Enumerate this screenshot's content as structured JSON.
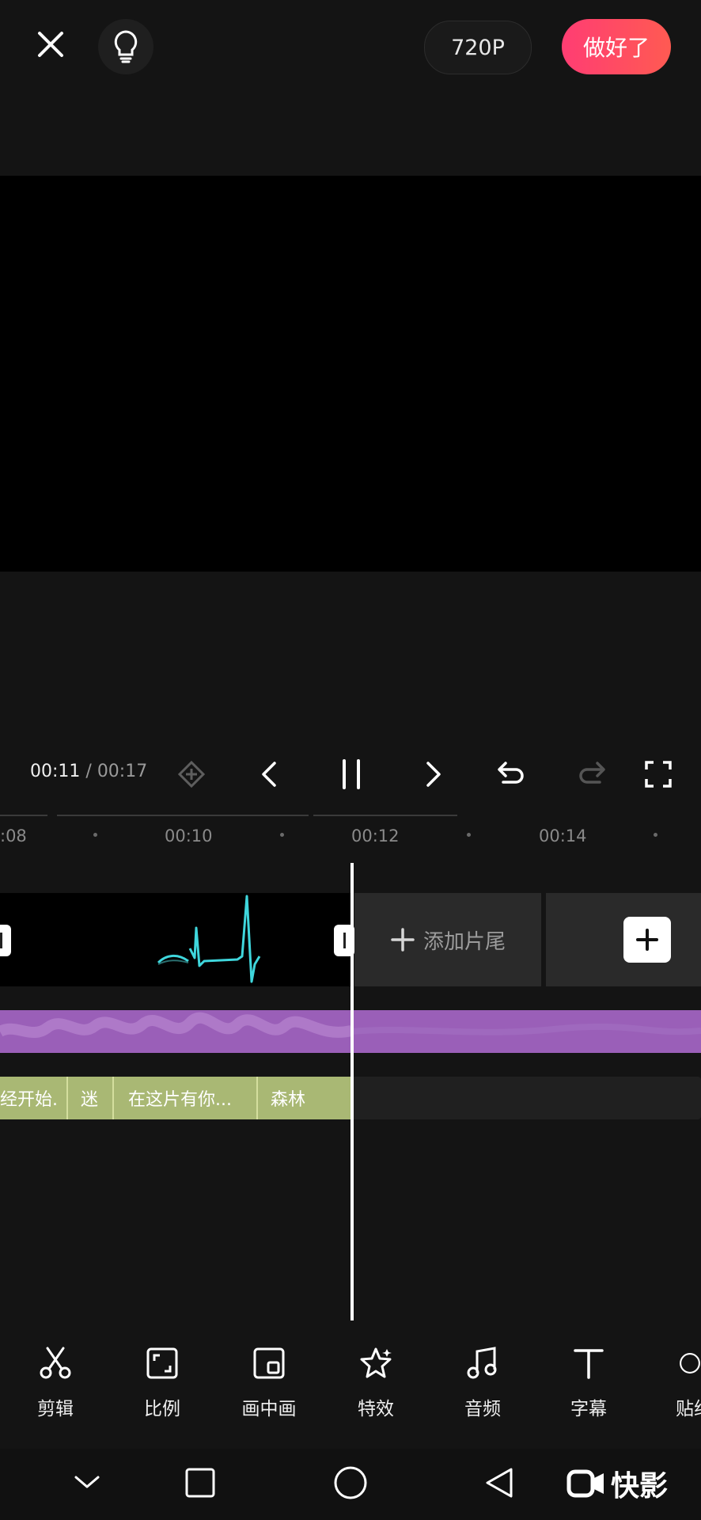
{
  "header": {
    "quality_label": "720P",
    "done_label": "做好了"
  },
  "player": {
    "current_time": "00:11",
    "separator": " / ",
    "total_time": "00:17"
  },
  "ruler": {
    "ticks": [
      ":08",
      "00:10",
      "00:12",
      "00:14"
    ]
  },
  "timeline": {
    "add_ending_label": "添加片尾",
    "captions": [
      "经开始.",
      "迷",
      "在这片有你...",
      "森林"
    ]
  },
  "toolbar": {
    "items": [
      {
        "label": "剪辑",
        "icon": "scissors-icon"
      },
      {
        "label": "比例",
        "icon": "ratio-icon"
      },
      {
        "label": "画中画",
        "icon": "picture-in-picture-icon"
      },
      {
        "label": "特效",
        "icon": "effects-star-icon"
      },
      {
        "label": "音频",
        "icon": "music-note-icon"
      },
      {
        "label": "字幕",
        "icon": "text-icon"
      },
      {
        "label": "贴纸",
        "icon": "sticker-icon"
      }
    ]
  },
  "watermark": {
    "text": "快影"
  },
  "colors": {
    "accent": "#ff4466",
    "audio": "#9a5fb8",
    "caption": "#a9b874",
    "waveform": "#3fd6dc"
  }
}
